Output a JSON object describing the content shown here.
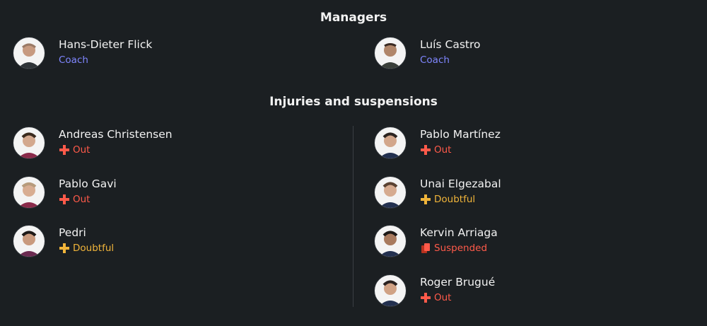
{
  "managers_title": "Managers",
  "managers": [
    {
      "name": "Hans-Dieter Flick",
      "role": "Coach"
    },
    {
      "name": "Luís Castro",
      "role": "Coach"
    }
  ],
  "injuries_title": "Injuries and suspensions",
  "left": [
    {
      "name": "Andreas Christensen",
      "status": "Out",
      "icon": "cross-icon",
      "color": "#ff5a4a"
    },
    {
      "name": "Pablo Gavi",
      "status": "Out",
      "icon": "cross-icon",
      "color": "#ff5a4a"
    },
    {
      "name": "Pedri",
      "status": "Doubtful",
      "icon": "cross-icon",
      "color": "#f0b43a"
    }
  ],
  "right": [
    {
      "name": "Pablo Martínez",
      "status": "Out",
      "icon": "cross-icon",
      "color": "#ff5a4a"
    },
    {
      "name": "Unai Elgezabal",
      "status": "Doubtful",
      "icon": "cross-icon",
      "color": "#f0b43a"
    },
    {
      "name": "Kervin Arriaga",
      "status": "Suspended",
      "icon": "red-card-icon",
      "color": "#ff5a4a"
    },
    {
      "name": "Roger Brugué",
      "status": "Out",
      "icon": "cross-icon",
      "color": "#ff5a4a"
    }
  ],
  "colors": {
    "background": "#1b1f22",
    "coach": "#7f86ff",
    "out": "#ff5a4a",
    "doubtful": "#f0b43a"
  }
}
